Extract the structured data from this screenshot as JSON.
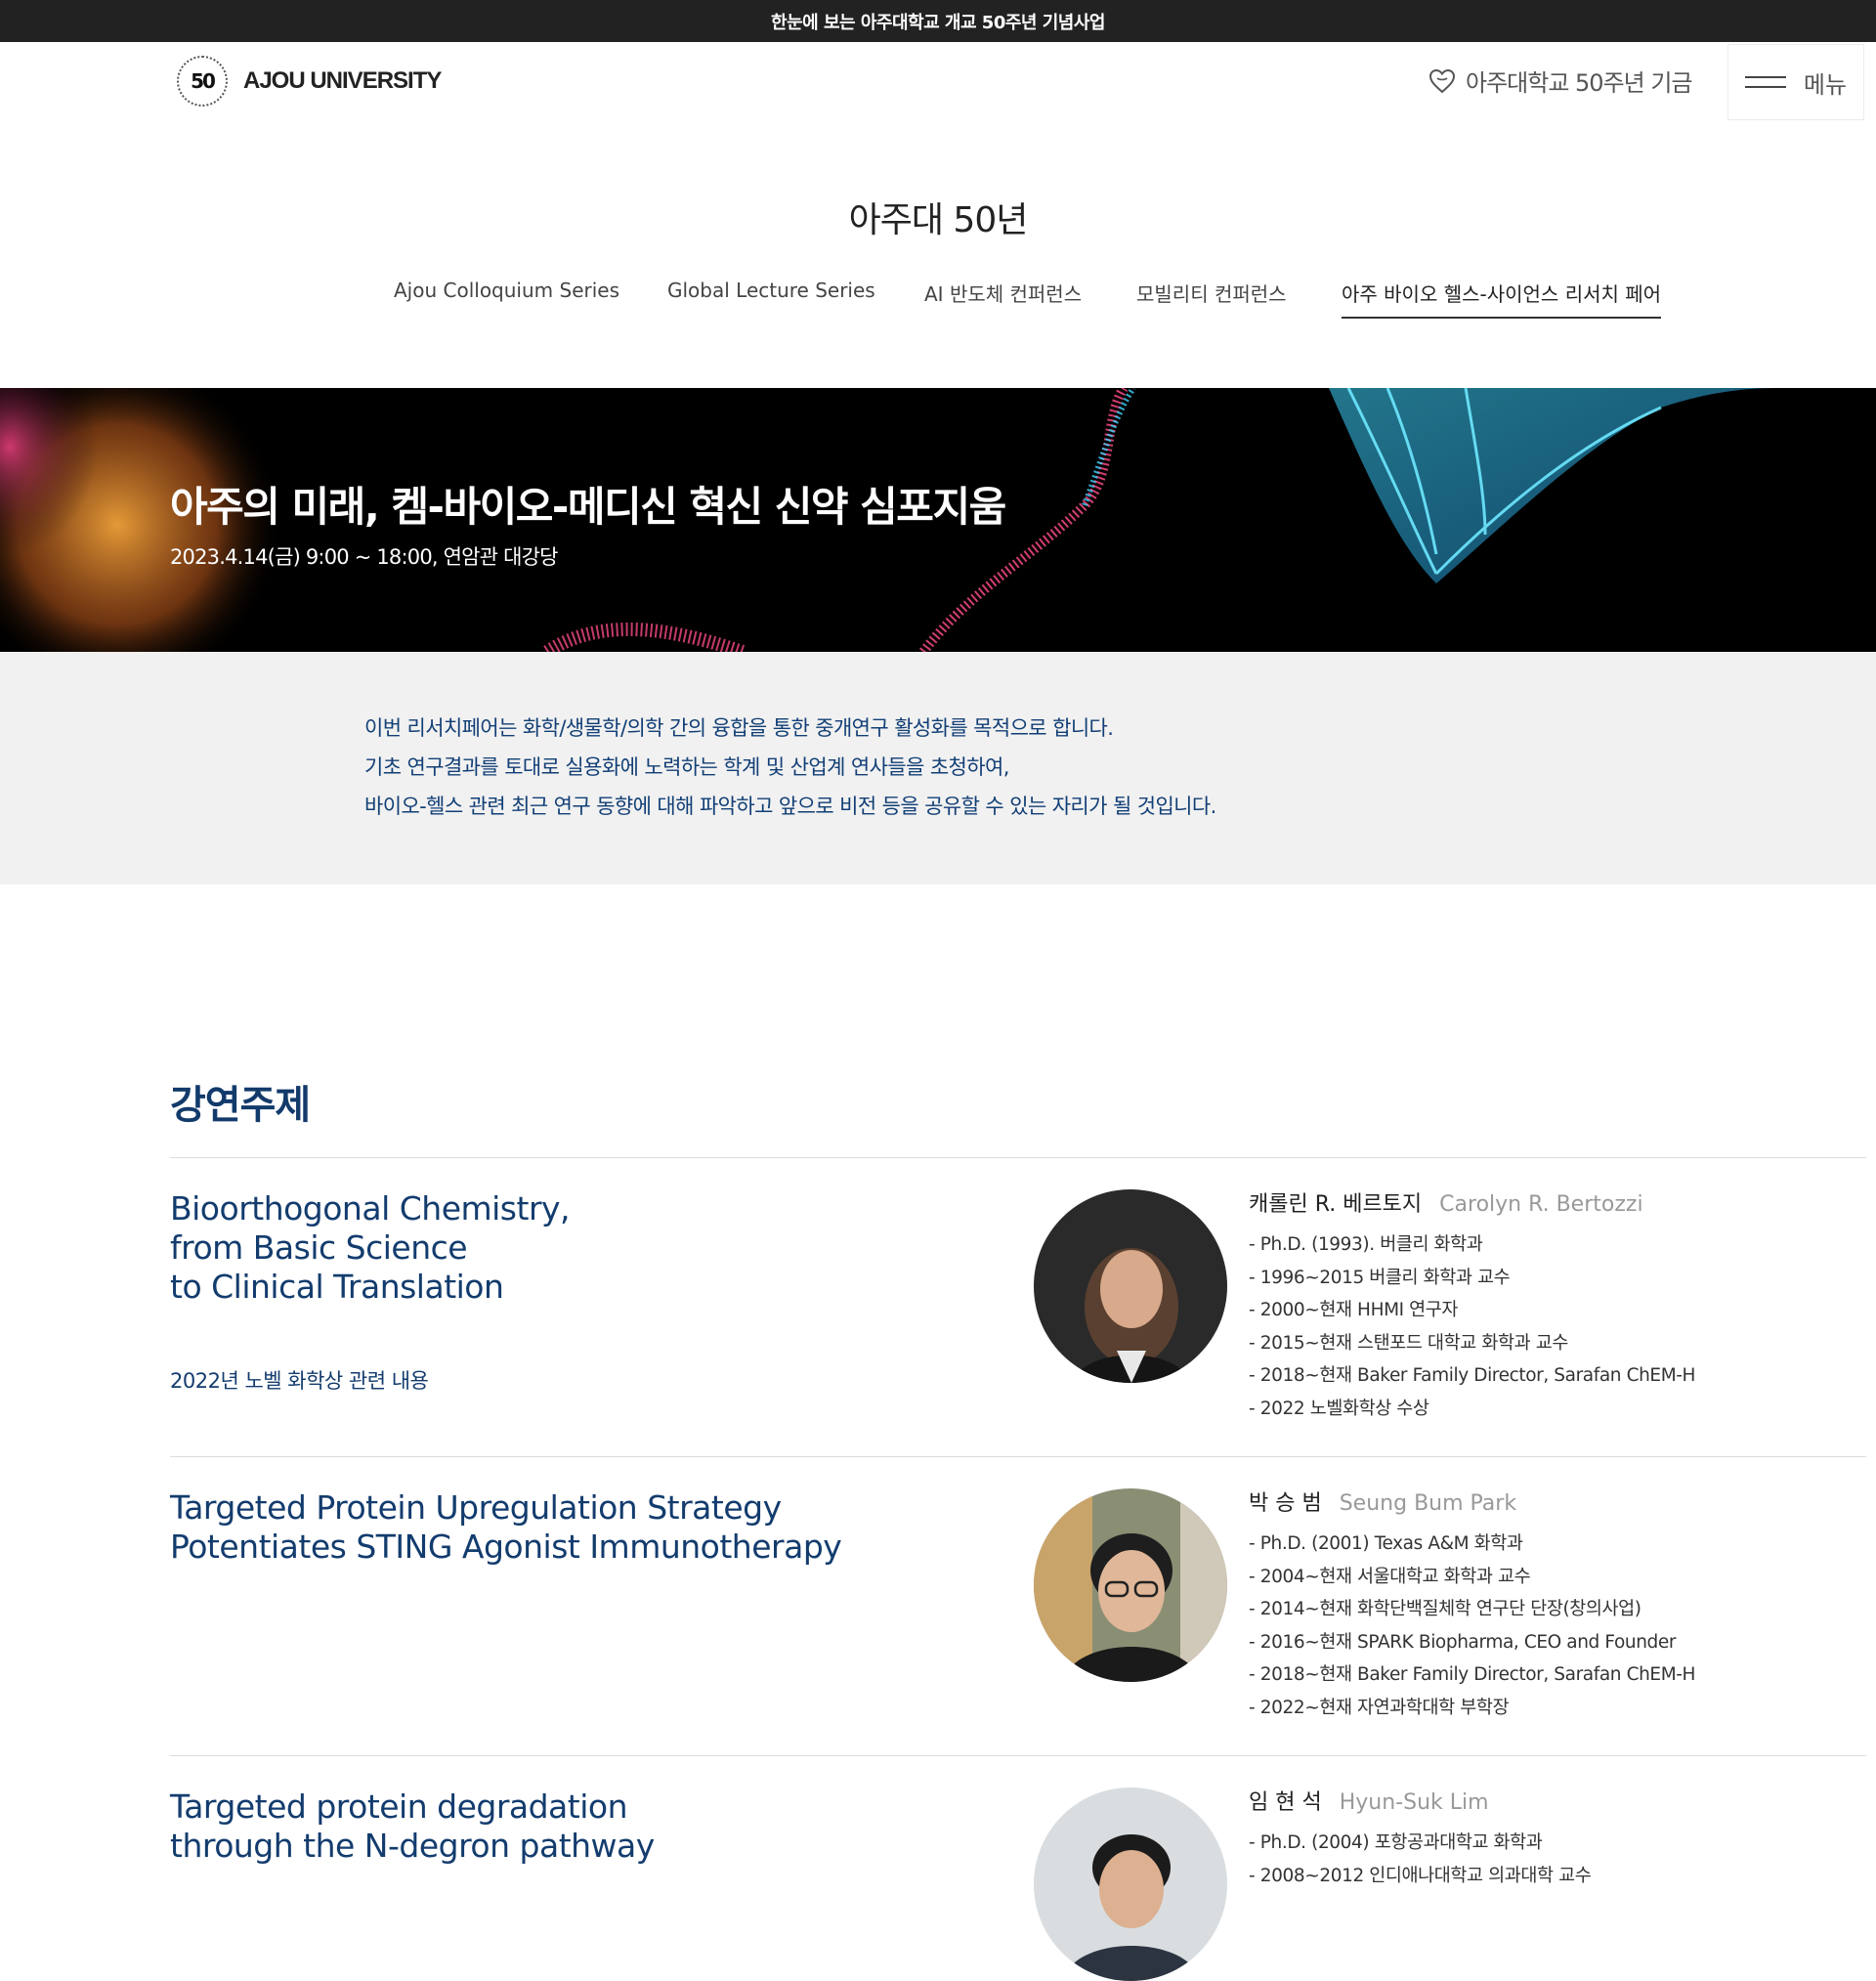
{
  "topbar": {
    "text": "한눈에 보는 아주대학교 개교 50주년 기념사업"
  },
  "header": {
    "logo_mark": "50",
    "logo_text": "AJOU UNIVERSITY",
    "fund_label": "아주대학교 50주년 기금",
    "menu_label": "메뉴"
  },
  "page_title": "아주대 50년",
  "tabs": [
    {
      "label": "Ajou Colloquium Series"
    },
    {
      "label": "Global Lecture Series"
    },
    {
      "label": "AI 반도체 컨퍼런스"
    },
    {
      "label": "모빌리티 컨퍼런스"
    },
    {
      "label": "아주 바이오 헬스-사이언스 리서치 페어",
      "active": true
    }
  ],
  "hero": {
    "title": "아주의 미래, 켐-바이오-메디신 혁신 신약 심포지움",
    "date": "2023.4.14(금) 9:00 ~ 18:00, 연암관 대강당"
  },
  "intro": {
    "lines": [
      "이번 리서치페어는 화학/생물학/의학 간의 융합을 통한 중개연구 활성화를 목적으로 합니다.",
      "기초 연구결과를 토대로 실용화에 노력하는 학계 및 산업계 연사들을 초청하여,",
      "바이오-헬스 관련 최근 연구 동향에 대해 파악하고 앞으로 비전 등을 공유할 수 있는 자리가 될 것입니다."
    ]
  },
  "section_title": "강연주제",
  "talks": [
    {
      "topic_lines": [
        "Bioorthogonal Chemistry,",
        "from Basic Science",
        "to Clinical Translation"
      ],
      "note": "2022년 노벨 화학상 관련 내용",
      "speaker_ko": "캐롤린 R. 베르토지",
      "speaker_en": "Carolyn R. Bertozzi",
      "cv": [
        "- Ph.D. (1993). 버클리 화학과",
        "- 1996~2015 버클리 화학과 교수",
        "- 2000~현재 HHMI 연구자",
        "- 2015~현재 스탠포드 대학교 화학과 교수",
        "- 2018~현재 Baker Family Director, Sarafan ChEM-H",
        "- 2022 노벨화학상 수상"
      ]
    },
    {
      "topic_lines": [
        "Targeted Protein Upregulation Strategy",
        "Potentiates STING Agonist Immunotherapy"
      ],
      "note": "",
      "speaker_ko": "박 승 범",
      "speaker_en": "Seung Bum Park",
      "cv": [
        "- Ph.D. (2001) Texas A&M 화학과",
        "- 2004~현재 서울대학교 화학과 교수",
        "- 2014~현재 화학단백질체학 연구단 단장(창의사업)",
        "- 2016~현재 SPARK Biopharma, CEO and Founder",
        "- 2018~현재 Baker Family Director, Sarafan ChEM-H",
        "- 2022~현재 자연과학대학 부학장"
      ]
    },
    {
      "topic_lines": [
        "Targeted protein degradation",
        "through the N-degron pathway"
      ],
      "note": "",
      "speaker_ko": "임 현 석",
      "speaker_en": "Hyun-Suk Lim",
      "cv": [
        "- Ph.D. (2004) 포항공과대학교 화학과",
        "- 2008~2012 인디애나대학교 의과대학 교수"
      ]
    }
  ]
}
